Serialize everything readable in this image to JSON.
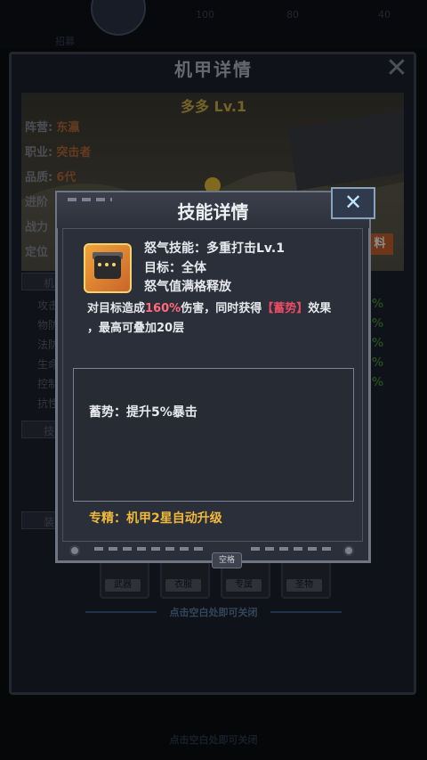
{
  "top": {
    "faint_labels": [
      "100",
      "80",
      "40"
    ],
    "sub_label": "招募"
  },
  "mech": {
    "title": "机甲详情",
    "close_glyph": "✕",
    "hero_name": "多多 Lv.1",
    "attributes": [
      {
        "label": "阵营:",
        "value": "东瀛"
      },
      {
        "label": "职业:",
        "value": "突击者"
      },
      {
        "label": "品质:",
        "value": "6代"
      },
      {
        "label": "进阶",
        "value": ""
      },
      {
        "label": "战力",
        "value": ""
      },
      {
        "label": "定位",
        "value": ""
      }
    ],
    "stat_labels": [
      "攻击",
      "物防",
      "法防",
      "生命",
      "控制",
      "抗性"
    ],
    "stat_pcts": [
      "%",
      "%",
      "%",
      "%",
      "%"
    ],
    "section_a": "机",
    "section_b": "技",
    "section_c": "装",
    "side_btn": "料",
    "equip_labels": [
      "武器",
      "衣服",
      "专属",
      "圣物"
    ],
    "hint": "点击空白处即可关闭",
    "bottom_hint": "点击空白处即可关闭"
  },
  "dialog": {
    "title": "技能详情",
    "close_glyph": "✕",
    "skill_name": "怒气技能：多重打击Lv.1",
    "target": "目标：全体",
    "release": "怒气值满格释放",
    "desc_prefix": "对目标造成",
    "desc_pct": "160%",
    "desc_mid": "伤害，同时获得",
    "desc_bracket": "【蓄势】",
    "desc_suffix": "效果",
    "desc_line2": "，最高可叠加20层",
    "buff": "蓄势：提升5%暴击",
    "special": "专精：机甲2星自动升级",
    "space_tag": "空格"
  },
  "colors": {
    "accent_red": "#ff6b7a",
    "gold": "#f0b93a",
    "panel": "#2b2f39"
  }
}
